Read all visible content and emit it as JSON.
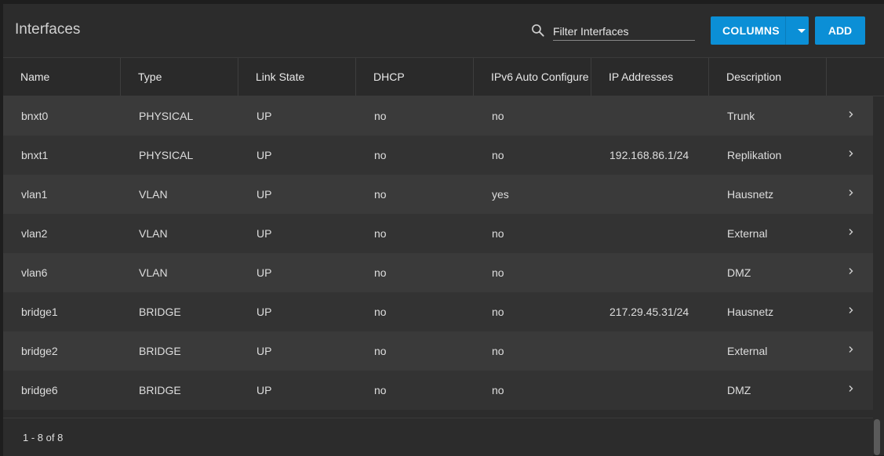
{
  "header": {
    "title": "Interfaces",
    "search_placeholder": "Filter Interfaces",
    "columns_label": "COLUMNS",
    "add_label": "ADD"
  },
  "table": {
    "columns": [
      "Name",
      "Type",
      "Link State",
      "DHCP",
      "IPv6 Auto Configure",
      "IP Addresses",
      "Description"
    ],
    "rows": [
      {
        "name": "bnxt0",
        "type": "PHYSICAL",
        "link": "UP",
        "dhcp": "no",
        "ipv6": "no",
        "ip": "",
        "desc": "Trunk"
      },
      {
        "name": "bnxt1",
        "type": "PHYSICAL",
        "link": "UP",
        "dhcp": "no",
        "ipv6": "no",
        "ip": "192.168.86.1/24",
        "desc": "Replikation"
      },
      {
        "name": "vlan1",
        "type": "VLAN",
        "link": "UP",
        "dhcp": "no",
        "ipv6": "yes",
        "ip": "",
        "desc": "Hausnetz"
      },
      {
        "name": "vlan2",
        "type": "VLAN",
        "link": "UP",
        "dhcp": "no",
        "ipv6": "no",
        "ip": "",
        "desc": "External"
      },
      {
        "name": "vlan6",
        "type": "VLAN",
        "link": "UP",
        "dhcp": "no",
        "ipv6": "no",
        "ip": "",
        "desc": "DMZ"
      },
      {
        "name": "bridge1",
        "type": "BRIDGE",
        "link": "UP",
        "dhcp": "no",
        "ipv6": "no",
        "ip": "217.29.45.31/24",
        "desc": "Hausnetz"
      },
      {
        "name": "bridge2",
        "type": "BRIDGE",
        "link": "UP",
        "dhcp": "no",
        "ipv6": "no",
        "ip": "",
        "desc": "External"
      },
      {
        "name": "bridge6",
        "type": "BRIDGE",
        "link": "UP",
        "dhcp": "no",
        "ipv6": "no",
        "ip": "",
        "desc": "DMZ"
      }
    ]
  },
  "footer": {
    "pagination": "1 - 8 of 8"
  },
  "colors": {
    "accent": "#0b8fd6",
    "background": "#2c2c2c"
  }
}
